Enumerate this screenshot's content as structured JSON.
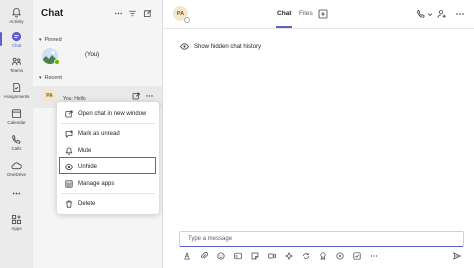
{
  "rail": {
    "items": [
      {
        "label": "Activity",
        "icon": "bell-icon"
      },
      {
        "label": "Chat",
        "icon": "chat-icon",
        "active": true
      },
      {
        "label": "Teams",
        "icon": "teams-icon"
      },
      {
        "label": "Assignments",
        "icon": "assignments-icon"
      },
      {
        "label": "Calendar",
        "icon": "calendar-icon"
      },
      {
        "label": "Calls",
        "icon": "phone-icon"
      },
      {
        "label": "OneDrive",
        "icon": "cloud-icon"
      },
      {
        "label": "Apps",
        "icon": "apps-icon"
      }
    ],
    "accent": "#5b5fc7"
  },
  "chat_list": {
    "title": "Chat",
    "sections": {
      "pinned": "Pinned",
      "recent": "Recent"
    },
    "pinned": [
      {
        "name": "(You)"
      }
    ],
    "recent": [
      {
        "initials": "PA",
        "preview": "You: Hello"
      }
    ]
  },
  "context_menu": {
    "items": [
      {
        "label": "Open chat in new window",
        "icon": "open-window-icon"
      },
      {
        "label": "Mark as unread",
        "icon": "mark-unread-icon"
      },
      {
        "label": "Mute",
        "icon": "bell-icon"
      },
      {
        "label": "Unhide",
        "icon": "eye-icon",
        "highlighted": true
      },
      {
        "label": "Manage apps",
        "icon": "manage-apps-icon"
      },
      {
        "label": "Delete",
        "icon": "trash-icon"
      }
    ],
    "highlight_color": "#e03a3a"
  },
  "conversation": {
    "initials": "PA",
    "tabs": [
      {
        "label": "Chat",
        "active": true
      },
      {
        "label": "Files"
      }
    ],
    "hidden_notice": "Show hidden chat history",
    "compose_placeholder": "Type a message"
  }
}
